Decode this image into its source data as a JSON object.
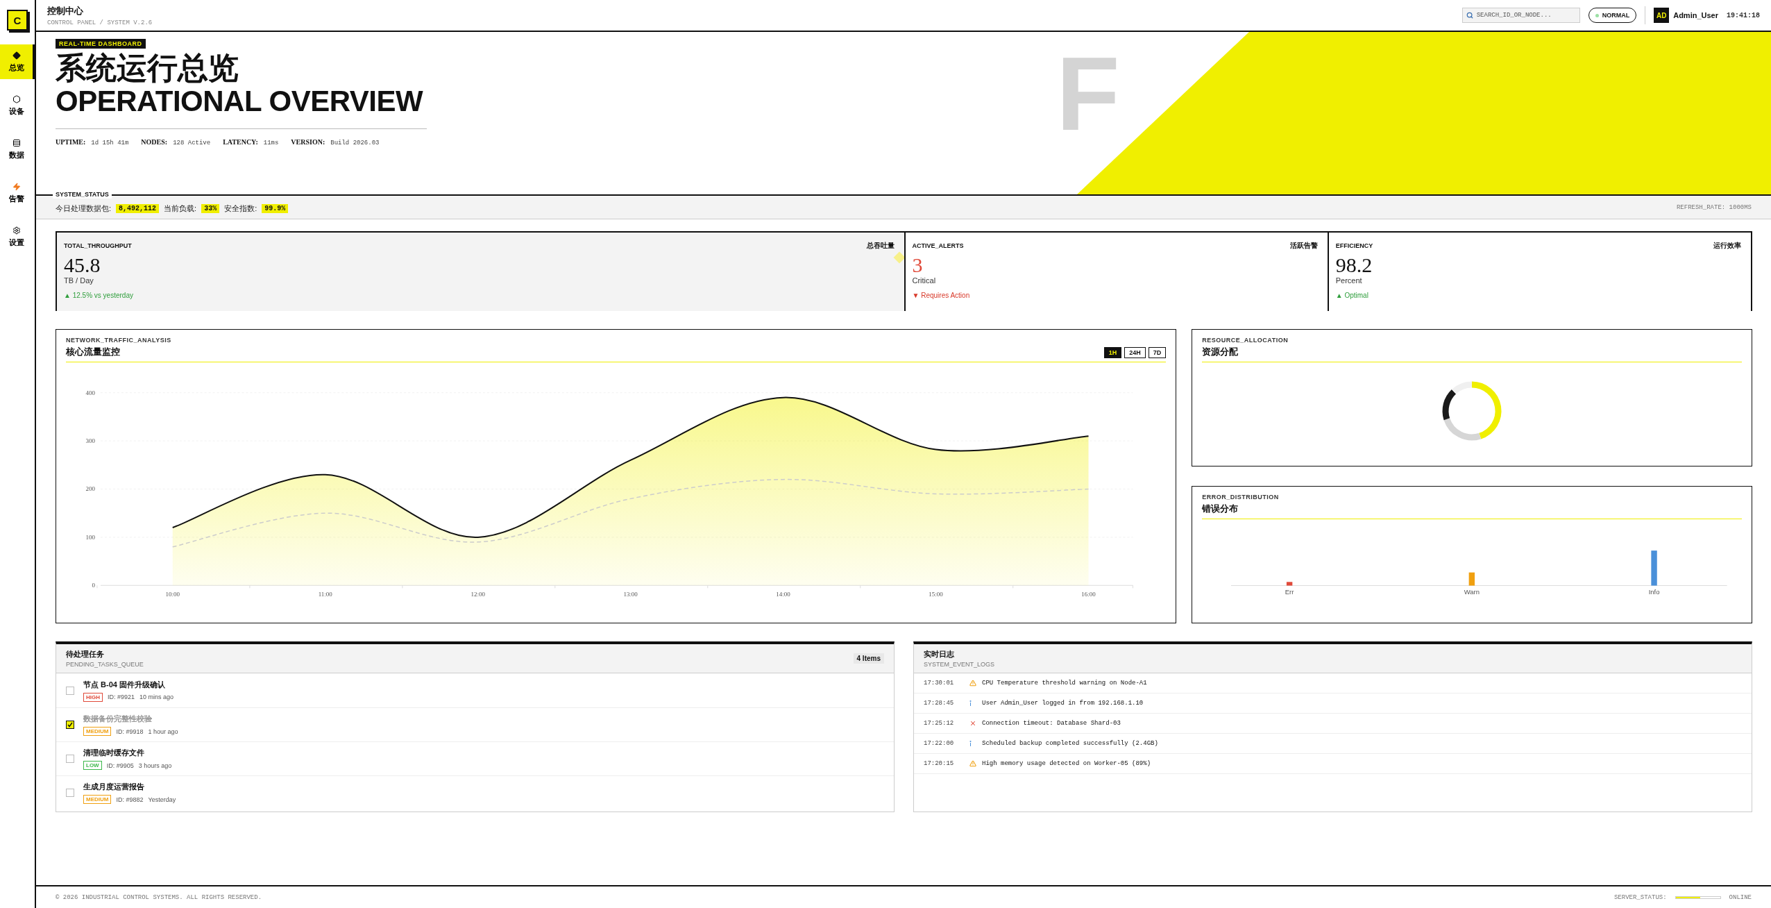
{
  "sidebar": {
    "logo": "C",
    "items": [
      {
        "label": "总览",
        "selected": true
      },
      {
        "label": "设备",
        "selected": false
      },
      {
        "label": "数据",
        "selected": false
      },
      {
        "label": "告警",
        "selected": false
      },
      {
        "label": "设置",
        "selected": false
      }
    ]
  },
  "header": {
    "title": "控制中心",
    "subtitle": "CONTROL PANEL / SYSTEM V.2.6",
    "search": {
      "placeholder": "SEARCH_ID_OR_NODE..."
    },
    "status": {
      "label": "NORMAL",
      "ok": true
    },
    "user": {
      "initials": "AD",
      "name": "Admin_User",
      "time": "19:41:18"
    }
  },
  "hero": {
    "badge": "REAL-TIME DASHBOARD",
    "title_cn": "系统运行总览",
    "title_en": "OPERATIONAL OVERVIEW",
    "backdrop_text": "F",
    "meta": [
      {
        "label": "UPTIME:",
        "value": "1d 15h 41m"
      },
      {
        "label": "NODES:",
        "value": "128 Active"
      },
      {
        "label": "LATENCY:",
        "value": "11ms"
      },
      {
        "label": "VERSION:",
        "value": "Build 2026.03"
      }
    ]
  },
  "status_bar": {
    "legend": "SYSTEM_STATUS",
    "items": [
      {
        "label": "今日处理数据包:",
        "value": "8,492,112"
      },
      {
        "label": "当前负载:",
        "value": "33%"
      },
      {
        "label": "安全指数:",
        "value": "99.9%"
      }
    ],
    "refresh": "REFRESH_RATE: 1000MS"
  },
  "cards": [
    {
      "title": "TOTAL_THROUGHPUT",
      "tag": "总吞吐量",
      "value": "45.8",
      "unit": "TB / Day",
      "positive": true,
      "note": "▲ 12.5% vs yesterday",
      "highlighted": true,
      "critical": false
    },
    {
      "title": "ACTIVE_ALERTS",
      "tag": "活跃告警",
      "value": "3",
      "unit": "Critical",
      "positive": false,
      "note": "▼ Requires Action",
      "highlighted": false,
      "critical": true
    },
    {
      "title": "EFFICIENCY",
      "tag": "运行效率",
      "value": "98.2",
      "unit": "Percent",
      "positive": true,
      "note": "▲ Optimal",
      "highlighted": false,
      "critical": false
    }
  ],
  "traffic_panel": {
    "eyebrow": "NETWORK_TRAFFIC_ANALYSIS",
    "title": "核心流量监控",
    "ranges": [
      {
        "label": "1H",
        "selected": true
      },
      {
        "label": "24H",
        "selected": false
      },
      {
        "label": "7D",
        "selected": false
      }
    ],
    "chart_data": {
      "type": "area",
      "grid": true,
      "x": [
        "10:00",
        "11:00",
        "12:00",
        "13:00",
        "14:00",
        "15:00",
        "16:00"
      ],
      "yticks": [
        0,
        100,
        200,
        300,
        400
      ],
      "ylim": [
        0,
        400
      ],
      "series": [
        {
          "color": "#111111",
          "line_style": "solid",
          "values": [
            120,
            230,
            100,
            260,
            390,
            282,
            310
          ]
        },
        {
          "type": "line",
          "color": "#cccccc",
          "line_style": "dashed",
          "values": [
            80,
            150,
            90,
            180,
            220,
            190,
            200
          ]
        }
      ]
    }
  },
  "resource_panel": {
    "eyebrow": "RESOURCE_ALLOCATION",
    "title": "资源分配"
  },
  "error_panel": {
    "eyebrow": "ERROR_DISTRIBUTION",
    "title": "错误分布",
    "categories": [
      {
        "label": "Err",
        "color": "#e04a3a"
      },
      {
        "label": "Warn",
        "color": "#f0a010"
      },
      {
        "label": "Info",
        "color": "#4a90d9"
      }
    ]
  },
  "tasks": {
    "title": "待处理任务",
    "subtitle": "PENDING_TASKS_QUEUE",
    "count": "4 Items",
    "items": [
      {
        "title": "节点 B-04 固件升级确认",
        "checked": false,
        "priority": {
          "label": "HIGH",
          "color": "#e04a3a"
        },
        "id": "ID: #9921",
        "time": "10 mins ago"
      },
      {
        "title": "数据备份完整性校验",
        "checked": true,
        "priority": {
          "label": "MEDIUM",
          "color": "#f0a010"
        },
        "id": "ID: #9918",
        "time": "1 hour ago"
      },
      {
        "title": "清理临时缓存文件",
        "checked": false,
        "priority": {
          "label": "LOW",
          "color": "#3cb84a"
        },
        "id": "ID: #9905",
        "time": "3 hours ago"
      },
      {
        "title": "生成月度运营报告",
        "checked": false,
        "priority": {
          "label": "MEDIUM",
          "color": "#f0a010"
        },
        "id": "ID: #9882",
        "time": "Yesterday"
      }
    ]
  },
  "logs": {
    "title": "实时日志",
    "subtitle": "SYSTEM_EVENT_LOGS",
    "entries": [
      {
        "time": "17:30:01",
        "kind": "warning",
        "message": "CPU Temperature threshold warning on Node-A1"
      },
      {
        "time": "17:28:45",
        "kind": "info",
        "message": "User Admin_User logged in from 192.168.1.10"
      },
      {
        "time": "17:25:12",
        "kind": "error",
        "message": "Connection timeout: Database Shard-03"
      },
      {
        "time": "17:22:00",
        "kind": "info",
        "message": "Scheduled backup completed successfully (2.4GB)"
      },
      {
        "time": "17:20:15",
        "kind": "warning",
        "message": "High memory usage detected on Worker-05 (89%)"
      }
    ]
  },
  "footer": {
    "copyright": "© 2026 INDUSTRIAL CONTROL SYSTEMS. ALL RIGHTS RESERVED.",
    "server_label": "SERVER_STATUS:",
    "server_status": {
      "level": 0.55
    },
    "server_state": "ONLINE"
  }
}
